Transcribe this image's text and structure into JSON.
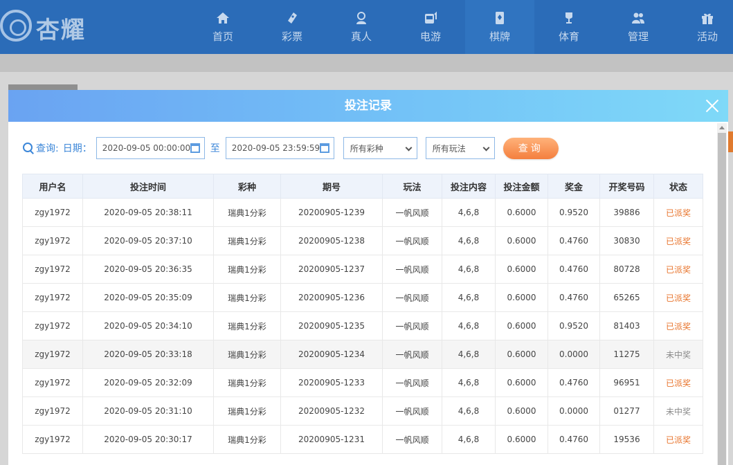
{
  "brand": {
    "name": "杏耀"
  },
  "nav": [
    {
      "label": "首页",
      "icon": "home-icon"
    },
    {
      "label": "彩票",
      "icon": "lottery-icon"
    },
    {
      "label": "真人",
      "icon": "live-dealer-icon"
    },
    {
      "label": "电游",
      "icon": "slot-machine-icon"
    },
    {
      "label": "棋牌",
      "icon": "card-game-icon"
    },
    {
      "label": "体育",
      "icon": "trophy-icon"
    },
    {
      "label": "管理",
      "icon": "user-management-icon"
    },
    {
      "label": "活动",
      "icon": "gift-icon"
    }
  ],
  "modal": {
    "title": "投注记录",
    "filters": {
      "query_label": "查询:",
      "date_label": "日期：",
      "start_date": "2020-09-05 00:00:00",
      "to_label": "至",
      "end_date": "2020-09-05 23:59:59",
      "lottery_select": "所有彩种",
      "play_select": "所有玩法",
      "query_button": "查询"
    },
    "table": {
      "headers": [
        "用户名",
        "投注时间",
        "彩种",
        "期号",
        "玩法",
        "投注内容",
        "投注金额",
        "奖金",
        "开奖号码",
        "状态"
      ],
      "rows": [
        [
          "zgy1972",
          "2020-09-05 20:38:11",
          "瑞典1分彩",
          "20200905-1239",
          "一帆风顺",
          "4,6,8",
          "0.6000",
          "0.9520",
          "39886",
          "已派奖"
        ],
        [
          "zgy1972",
          "2020-09-05 20:37:10",
          "瑞典1分彩",
          "20200905-1238",
          "一帆风顺",
          "4,6,8",
          "0.6000",
          "0.4760",
          "30830",
          "已派奖"
        ],
        [
          "zgy1972",
          "2020-09-05 20:36:35",
          "瑞典1分彩",
          "20200905-1237",
          "一帆风顺",
          "4,6,8",
          "0.6000",
          "0.4760",
          "80728",
          "已派奖"
        ],
        [
          "zgy1972",
          "2020-09-05 20:35:09",
          "瑞典1分彩",
          "20200905-1236",
          "一帆风顺",
          "4,6,8",
          "0.6000",
          "0.4760",
          "65265",
          "已派奖"
        ],
        [
          "zgy1972",
          "2020-09-05 20:34:10",
          "瑞典1分彩",
          "20200905-1235",
          "一帆风顺",
          "4,6,8",
          "0.6000",
          "0.9520",
          "81403",
          "已派奖"
        ],
        [
          "zgy1972",
          "2020-09-05 20:33:18",
          "瑞典1分彩",
          "20200905-1234",
          "一帆风顺",
          "4,6,8",
          "0.6000",
          "0.0000",
          "11275",
          "未中奖"
        ],
        [
          "zgy1972",
          "2020-09-05 20:32:09",
          "瑞典1分彩",
          "20200905-1233",
          "一帆风顺",
          "4,6,8",
          "0.6000",
          "0.4760",
          "96951",
          "已派奖"
        ],
        [
          "zgy1972",
          "2020-09-05 20:31:10",
          "瑞典1分彩",
          "20200905-1232",
          "一帆风顺",
          "4,6,8",
          "0.6000",
          "0.0000",
          "01277",
          "未中奖"
        ],
        [
          "zgy1972",
          "2020-09-05 20:30:17",
          "瑞典1分彩",
          "20200905-1231",
          "一帆风顺",
          "4,6,8",
          "0.6000",
          "0.4760",
          "19536",
          "已派奖"
        ]
      ]
    }
  },
  "colors": {
    "nav_bg": "#2b6cb8",
    "accent": "#3b86d8",
    "status_paid": "#e8742c",
    "status_lost": "#8a8a8a",
    "query_button": "#f47f3e"
  }
}
